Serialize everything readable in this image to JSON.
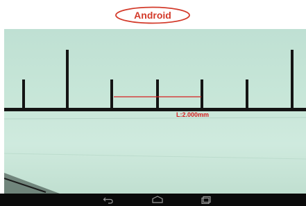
{
  "header": {
    "label": "Android",
    "label_color": "#d33a2a"
  },
  "measurement": {
    "label": "L:2.000mm",
    "color": "#d62020"
  },
  "toolbar": {
    "buttons": [
      {
        "name": "camera-icon"
      },
      {
        "name": "sun-icon"
      },
      {
        "name": "arrow-left-icon"
      },
      {
        "name": "arrow-up-icon"
      },
      {
        "name": "arrow-down-icon"
      },
      {
        "name": "arrow-right-icon"
      },
      {
        "name": "measure-icon"
      },
      {
        "name": "settings-icon"
      }
    ]
  },
  "navbar": {
    "buttons": [
      {
        "name": "back-icon"
      },
      {
        "name": "home-icon"
      },
      {
        "name": "recent-apps-icon"
      }
    ]
  }
}
